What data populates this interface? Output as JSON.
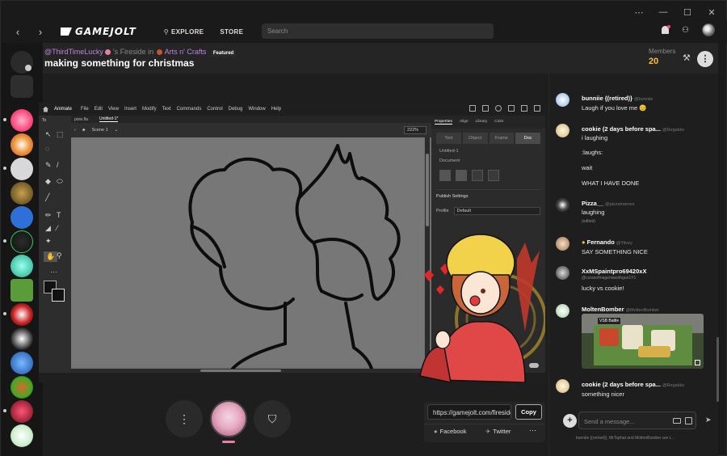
{
  "window": {
    "controls": [
      "⋯",
      "—",
      "☐",
      "✕"
    ]
  },
  "topbar": {
    "logo": "GAMEJOLT",
    "nav": [
      {
        "label": "EXPLORE",
        "icon": "compass-icon"
      },
      {
        "label": "STORE",
        "icon": ""
      }
    ],
    "search_placeholder": "Search"
  },
  "header": {
    "host": "@ThirdTimeLucky",
    "fireside_in": "'s Fireside in",
    "community": "Arts n' Crafts",
    "badge": "Featured",
    "title": "making something for christmas",
    "members_label": "Members",
    "members_count": "20"
  },
  "animate": {
    "app_name": "Animate",
    "menu": [
      "File",
      "Edit",
      "View",
      "Insert",
      "Modify",
      "Text",
      "Commands",
      "Control",
      "Debug",
      "Window",
      "Help"
    ],
    "tabs": [
      "pixie.fla",
      "Untitled-1*"
    ],
    "scene": "Scene 1",
    "zoom": "222%",
    "panel_tabs": [
      "Properties",
      "Align",
      "Library",
      "Color"
    ],
    "segments": [
      "Tool",
      "Object",
      "Frame",
      "Doc"
    ],
    "doc_name": "Untitled-1",
    "doc_label": "Document",
    "publish_settings": "Publish Settings",
    "profile_label": "Profile",
    "profile_value": "Default",
    "tools_label": "To"
  },
  "share": {
    "url": "https://gamejolt.com/fireside/@ThirdTimeLucky",
    "copy": "Copy",
    "facebook": "Facebook",
    "twitter": "Twitter"
  },
  "chat": {
    "messages": [
      {
        "name": "bunniie {(retired)}",
        "handle": "@bunniie",
        "lines": [
          "Laugh if you love me 😊"
        ]
      },
      {
        "name": "cookie (2 days before spa...",
        "handle": "@Regakko",
        "lines": [
          "i laughing",
          ":laughs:",
          "wait",
          "WHAT I HAVE DONE"
        ]
      },
      {
        "name": "Pizza__",
        "handle": "@pizzamemes",
        "lines": [
          "laughing"
        ],
        "note": "(edited)"
      },
      {
        "name": "Fernando",
        "handle": "@Yilvey",
        "lines": [
          "SAY SOMETHING NICE"
        ]
      },
      {
        "name": "XxMSpaintpro69420xX",
        "handle": "@curseofmagenowothgun1Y1",
        "lines": [
          "lucky vs cookie!"
        ]
      },
      {
        "name": "MoltenBomber",
        "handle": "@MoltenBomber",
        "lines": []
      },
      {
        "name": "cookie (2 days before spa...",
        "handle": "@Regakko",
        "lines": [
          "something nicer"
        ]
      }
    ],
    "embed_tag": "VSB Battle",
    "placeholder": "Send a message...",
    "typing": "bunniie {(retired)}, MrTophat and MoltenBomber are t..."
  },
  "colors": {
    "accent_pink": "#e57fa4",
    "accent_purple": "#bc84e0",
    "members_gold": "#ffbc42"
  }
}
